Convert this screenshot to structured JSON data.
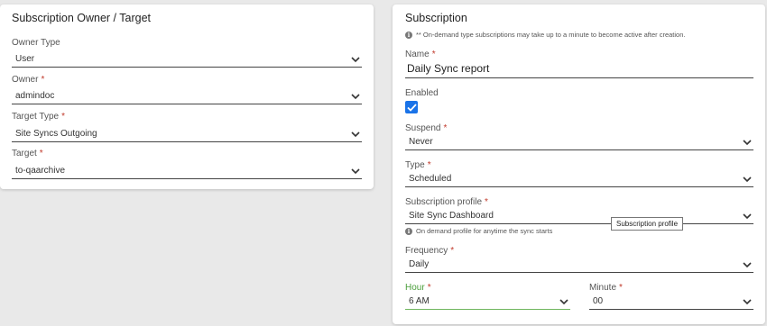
{
  "owner_card": {
    "title": "Subscription Owner / Target",
    "owner_type": {
      "label": "Owner Type",
      "value": "User"
    },
    "owner": {
      "label": "Owner",
      "value": "admindoc",
      "required": "*"
    },
    "target_type": {
      "label": "Target Type",
      "value": "Site Syncs Outgoing",
      "required": "*"
    },
    "target": {
      "label": "Target",
      "value": "to-qaarchive",
      "required": "*"
    }
  },
  "subscription_card": {
    "title": "Subscription",
    "notice": "** On-demand type subscriptions may take up to a minute to become active after creation.",
    "name": {
      "label": "Name",
      "value": "Daily Sync report",
      "required": "*"
    },
    "enabled": {
      "label": "Enabled",
      "checked": true
    },
    "suspend": {
      "label": "Suspend",
      "value": "Never",
      "required": "*"
    },
    "type": {
      "label": "Type",
      "value": "Scheduled",
      "required": "*"
    },
    "profile": {
      "label": "Subscription profile",
      "value": "Site Sync Dashboard",
      "required": "*",
      "hint": "On demand profile for anytime the sync starts",
      "tooltip": "Subscription profile"
    },
    "frequency": {
      "label": "Frequency",
      "value": "Daily",
      "required": "*"
    },
    "hour": {
      "label": "Hour",
      "value": "6 AM",
      "required": "*"
    },
    "minute": {
      "label": "Minute",
      "value": "00",
      "required": "*"
    }
  },
  "colors": {
    "accent_blue": "#1a73e8",
    "required_red": "#c0392b",
    "focus_green": "#4a9e3a"
  },
  "icons": {
    "dropdown": "chevron-down-icon",
    "info": "info-icon",
    "check": "check-icon"
  }
}
